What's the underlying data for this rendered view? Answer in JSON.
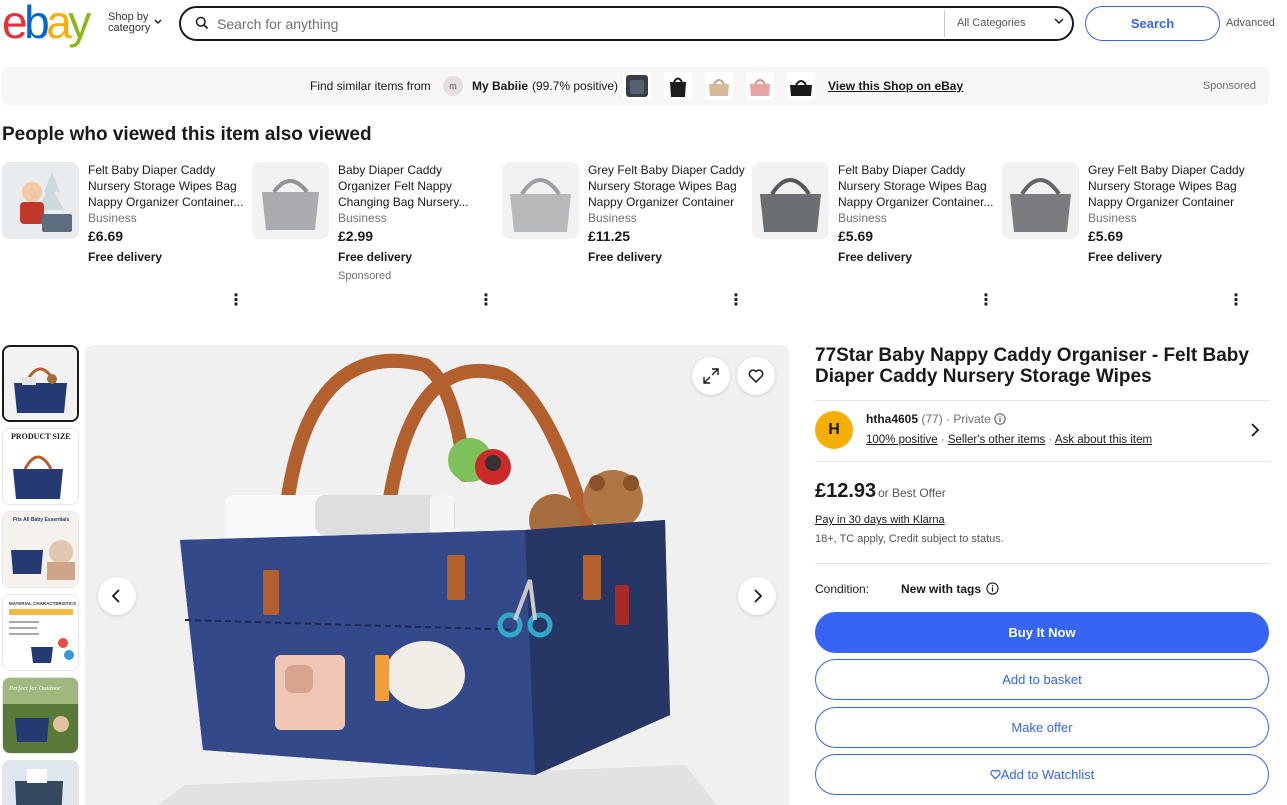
{
  "header": {
    "logo_letters": [
      "e",
      "b",
      "a",
      "y"
    ],
    "logo_colors": [
      "#e53238",
      "#0064d2",
      "#f5af02",
      "#86b817"
    ],
    "shop_by_line1": "Shop by",
    "shop_by_line2": "category",
    "search_placeholder": "Search for anything",
    "category_select": "All Categories",
    "search_button": "Search",
    "advanced_link": "Advanced"
  },
  "store_bar": {
    "find_text": "Find similar items from",
    "store_name": "My Babiie",
    "positive": "(99.7% positive)",
    "view_shop": "View this Shop on eBay",
    "sponsored": "Sponsored"
  },
  "also_viewed": {
    "title": "People who viewed this item also viewed",
    "items": [
      {
        "name": "Felt Baby Diaper Caddy Nursery Storage Wipes Bag Nappy Organizer Container...",
        "seller_type": "Business",
        "price": "£6.69",
        "delivery": "Free delivery",
        "sponsored": ""
      },
      {
        "name": "Baby Diaper Caddy Organizer Felt Nappy Changing Bag Nursery...",
        "seller_type": "Business",
        "price": "£2.99",
        "delivery": "Free delivery",
        "sponsored": "Sponsored"
      },
      {
        "name": "Grey Felt Baby Diaper Caddy Nursery Storage Wipes Bag Nappy Organizer Container",
        "seller_type": "Business",
        "price": "£11.25",
        "delivery": "Free delivery",
        "sponsored": ""
      },
      {
        "name": "Felt Baby Diaper Caddy Nursery Storage Wipes Bag Nappy Organizer Container...",
        "seller_type": "Business",
        "price": "£5.69",
        "delivery": "Free delivery",
        "sponsored": ""
      },
      {
        "name": "Grey Felt Baby Diaper Caddy Nursery Storage Wipes Bag Nappy Organizer Container",
        "seller_type": "Business",
        "price": "£5.69",
        "delivery": "Free delivery",
        "sponsored": ""
      }
    ]
  },
  "gallery": {
    "thumb_labels": [
      "PRODUCT SIZE",
      "Fits All Baby Essentials",
      "MATERIAL CHARACTERISTICS",
      "Perfect for Outdoor"
    ]
  },
  "product": {
    "title": "77Star Baby Nappy Caddy Organiser - Felt Baby Diaper Caddy Nursery Storage Wipes",
    "seller": {
      "avatar_letter": "H",
      "name": "htha4605",
      "feedback_count": "(77)",
      "type": "· Private",
      "positive": "100% positive",
      "other_items": "Seller's other items",
      "ask": "Ask about this item"
    },
    "price": "£12.93",
    "best_offer": "or Best Offer",
    "klarna": "Pay in 30 days with Klarna",
    "credit_note": "18+, TC apply, Credit subject to status.",
    "condition_label": "Condition:",
    "condition_value": "New with tags",
    "buy_now": "Buy It Now",
    "add_basket": "Add to basket",
    "make_offer": "Make offer",
    "watchlist": "Add to Watchlist"
  }
}
